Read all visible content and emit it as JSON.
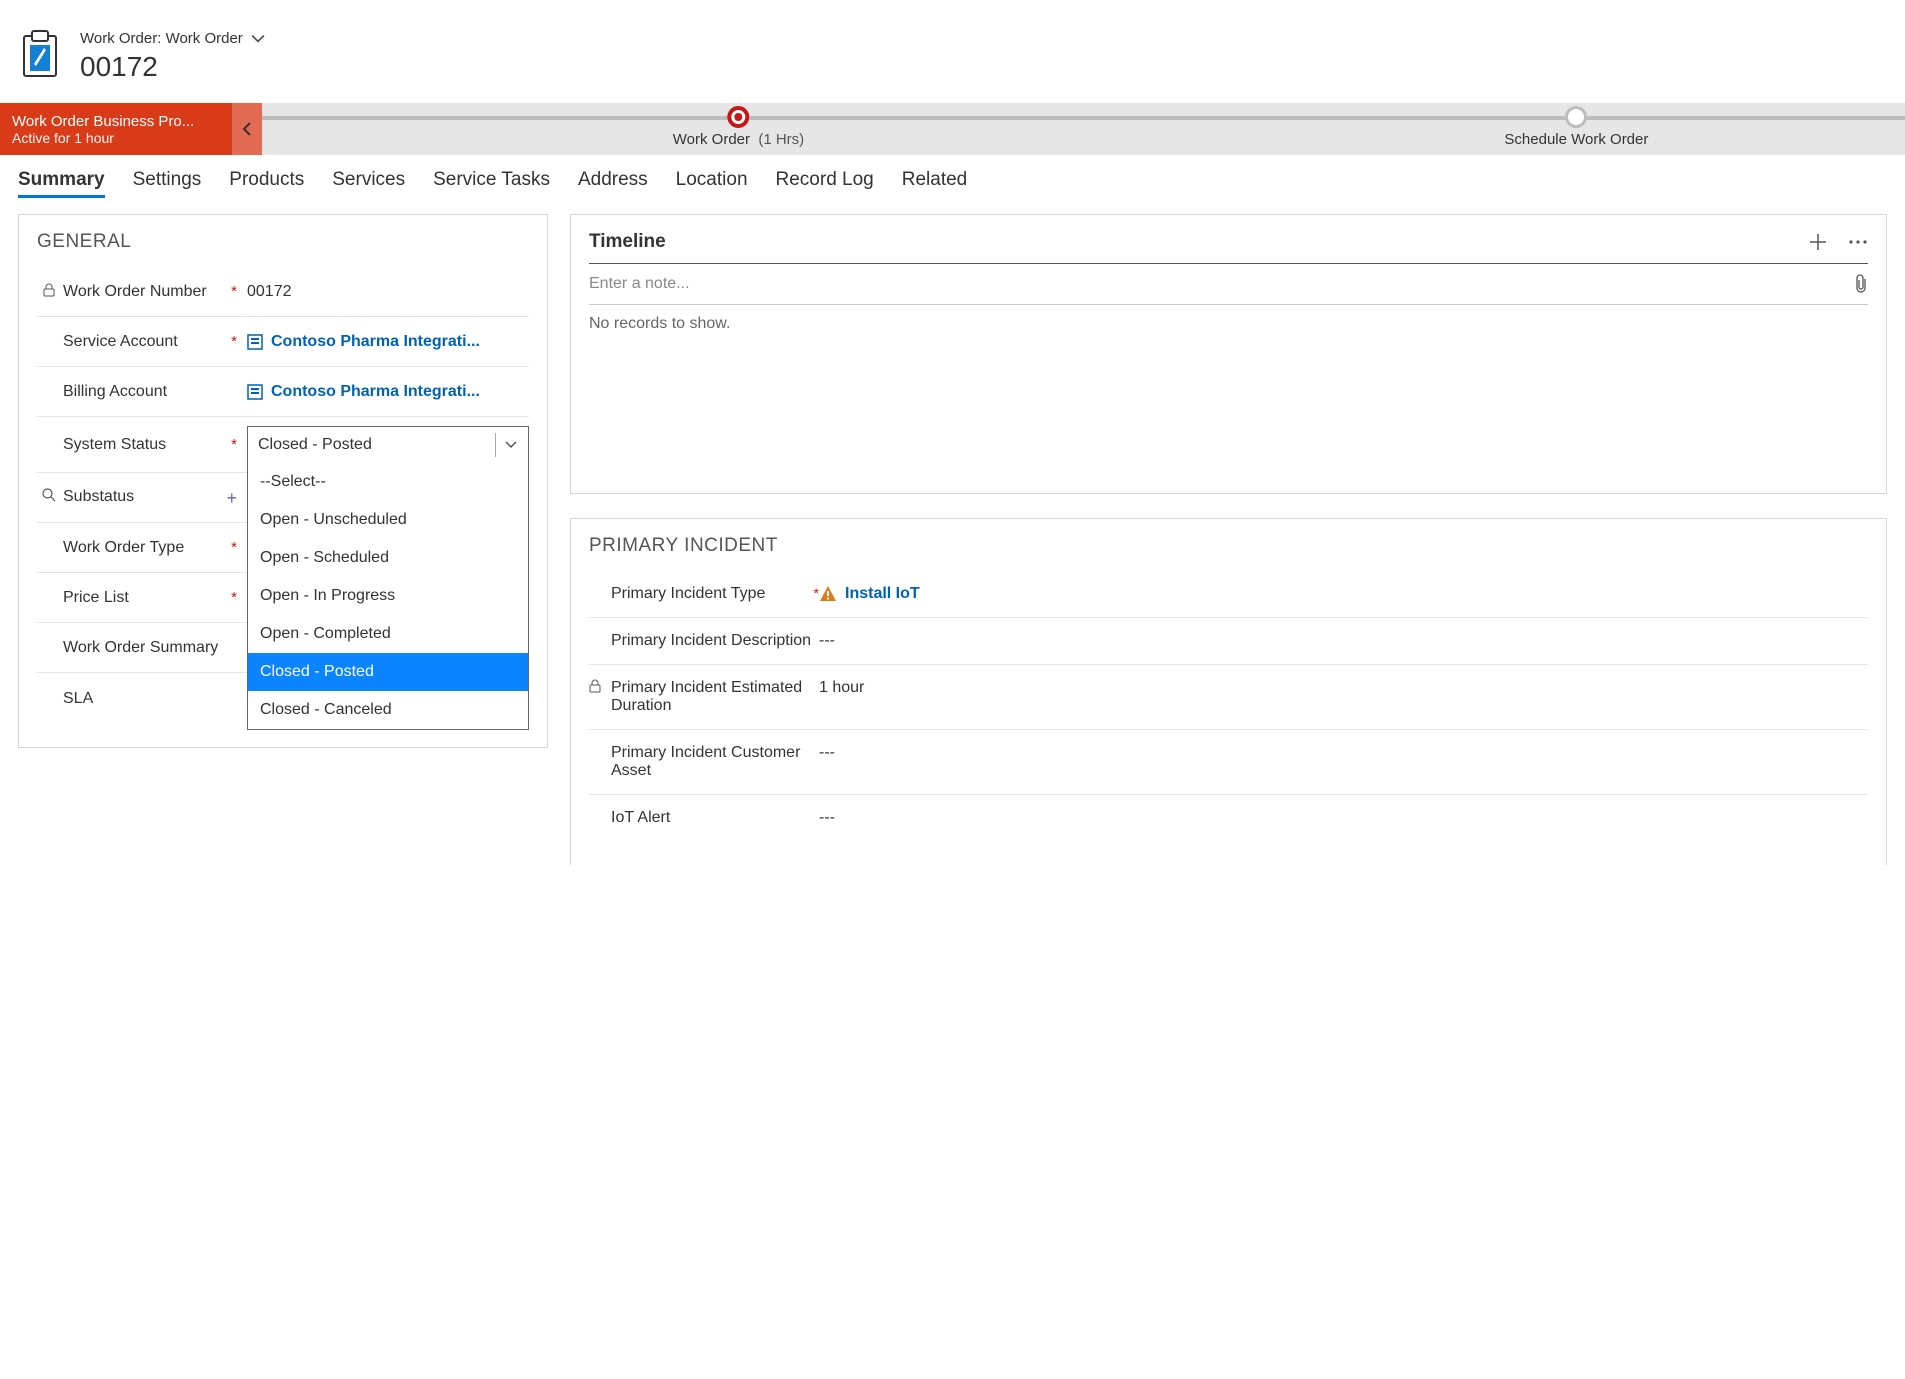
{
  "header": {
    "breadcrumb": "Work Order: Work Order",
    "title": "00172"
  },
  "bp": {
    "banner_title": "Work Order Business Pro...",
    "banner_sub": "Active for 1 hour",
    "stage1_label": "Work Order",
    "stage1_dur": "(1 Hrs)",
    "stage2_label": "Schedule Work Order"
  },
  "tabs": [
    "Summary",
    "Settings",
    "Products",
    "Services",
    "Service Tasks",
    "Address",
    "Location",
    "Record Log",
    "Related"
  ],
  "general": {
    "title": "GENERAL",
    "fields": {
      "work_order_number_label": "Work Order Number",
      "work_order_number_value": "00172",
      "service_account_label": "Service Account",
      "service_account_value": "Contoso Pharma Integrati...",
      "billing_account_label": "Billing Account",
      "billing_account_value": "Contoso Pharma Integrati...",
      "system_status_label": "System Status",
      "system_status_value": "Closed - Posted",
      "substatus_label": "Substatus",
      "work_order_type_label": "Work Order Type",
      "price_list_label": "Price List",
      "work_order_summary_label": "Work Order Summary",
      "sla_label": "SLA"
    },
    "status_options": [
      "--Select--",
      "Open - Unscheduled",
      "Open - Scheduled",
      "Open - In Progress",
      "Open - Completed",
      "Closed - Posted",
      "Closed - Canceled"
    ],
    "status_selected_index": 5
  },
  "timeline": {
    "title": "Timeline",
    "note_placeholder": "Enter a note...",
    "empty_text": "No records to show."
  },
  "primary_incident": {
    "title": "PRIMARY INCIDENT",
    "type_label": "Primary Incident Type",
    "type_value": "Install IoT",
    "desc_label": "Primary Incident Description",
    "desc_value": "---",
    "dur_label": "Primary Incident Estimated Duration",
    "dur_value": "1 hour",
    "asset_label": "Primary Incident Customer Asset",
    "asset_value": "---",
    "iot_label": "IoT Alert",
    "iot_value": "---"
  }
}
